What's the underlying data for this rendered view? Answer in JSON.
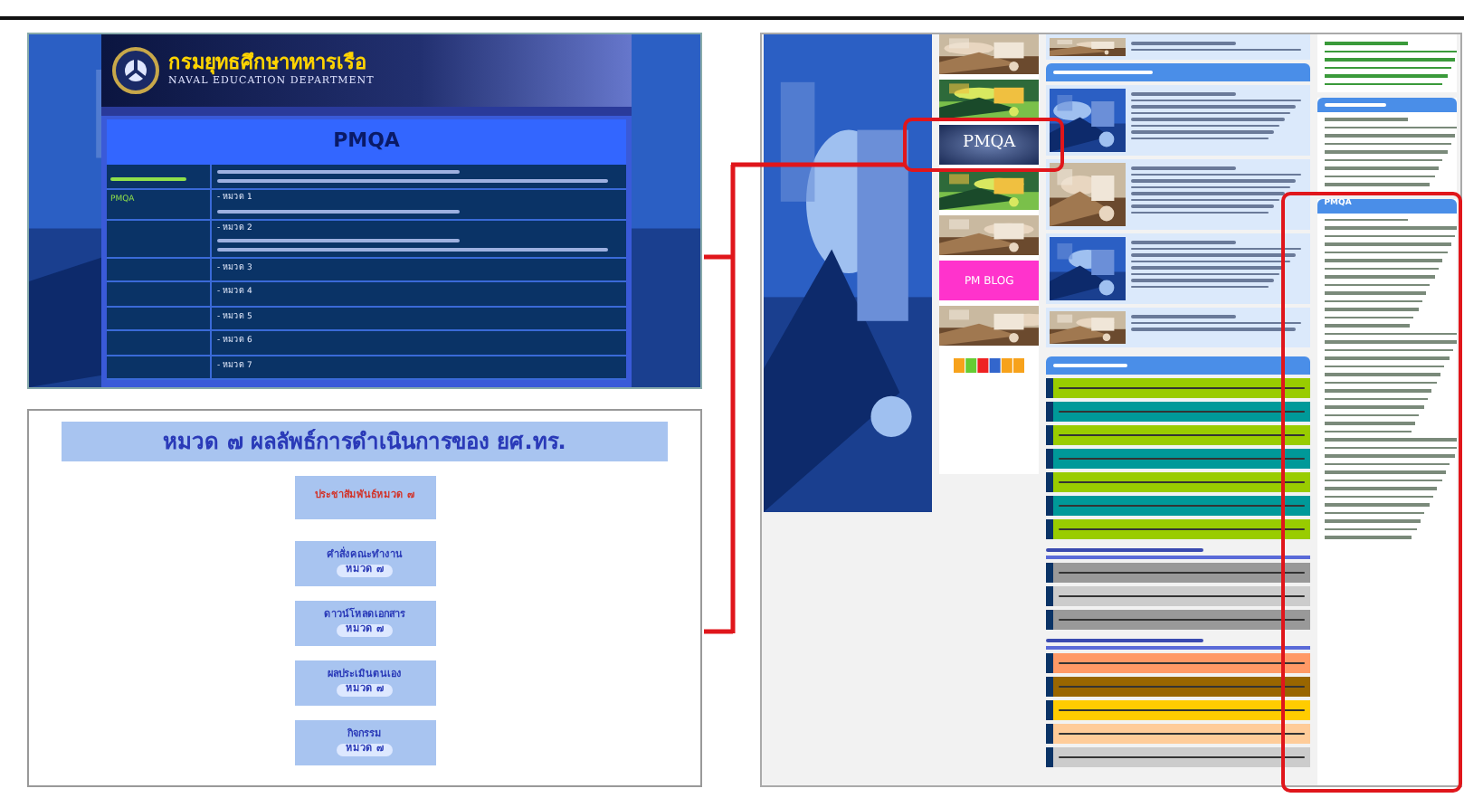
{
  "portal": {
    "title": "กรมยุทธศึกษาทหารเรือ",
    "subtitle": "NAVAL EDUCATION DEPARTMENT",
    "heading": "PMQA",
    "rows": [
      {
        "chapter": "- หมวด 1",
        "side_label": "PMQA"
      },
      {
        "chapter": "- หมวด 2"
      },
      {
        "chapter": "- หมวด 3"
      },
      {
        "chapter": "- หมวด 4"
      },
      {
        "chapter": "- หมวด 5"
      },
      {
        "chapter": "- หมวด 6"
      },
      {
        "chapter": "- หมวด 7"
      }
    ]
  },
  "chapter_page": {
    "heading": "หมวด ๗ ผลลัพธ์การดำเนินการของ ยศ.ทร.",
    "buttons": [
      {
        "kind": "announce",
        "label": "ประชาสัมพันธ์หมวด ๗"
      },
      {
        "kind": "chapter",
        "label": "คำสั่งคณะทำงาน",
        "tag": "หมวด ๗"
      },
      {
        "kind": "chapter",
        "label": "ดาวน์โหลดเอกสาร",
        "tag": "หมวด ๗"
      },
      {
        "kind": "chapter",
        "label": "ผลประเมินตนเอง",
        "tag": "หมวด ๗"
      },
      {
        "kind": "chapter",
        "label": "กิจกรรม",
        "tag": "หมวด ๗"
      }
    ]
  },
  "website": {
    "banners": [
      {
        "kind": "picture",
        "highlighted": false
      },
      {
        "kind": "picture",
        "highlighted": false
      },
      {
        "kind": "text",
        "label": "PMQA",
        "highlighted": true
      },
      {
        "kind": "picture",
        "highlighted": false
      },
      {
        "kind": "picture",
        "highlighted": false
      },
      {
        "kind": "blog",
        "label": "PM BLOG",
        "highlighted": false
      },
      {
        "kind": "picture",
        "highlighted": false
      }
    ],
    "news_rows": [
      {
        "color": "#99cc00"
      },
      {
        "color": "#009999"
      },
      {
        "color": "#99cc00"
      },
      {
        "color": "#009999"
      },
      {
        "color": "#99cc00"
      },
      {
        "color": "#009999"
      },
      {
        "color": "#99cc00"
      }
    ],
    "notice_rows": [
      {
        "color": "#999999"
      },
      {
        "color": "#cccccc"
      },
      {
        "color": "#999999"
      }
    ],
    "activity_rows": [
      {
        "color": "#ff9966"
      },
      {
        "color": "#996600"
      },
      {
        "color": "#ffcc00"
      },
      {
        "color": "#ffcc99"
      },
      {
        "color": "#cccccc"
      }
    ],
    "sidebar": {
      "title": "PMQA",
      "highlighted": true
    }
  }
}
